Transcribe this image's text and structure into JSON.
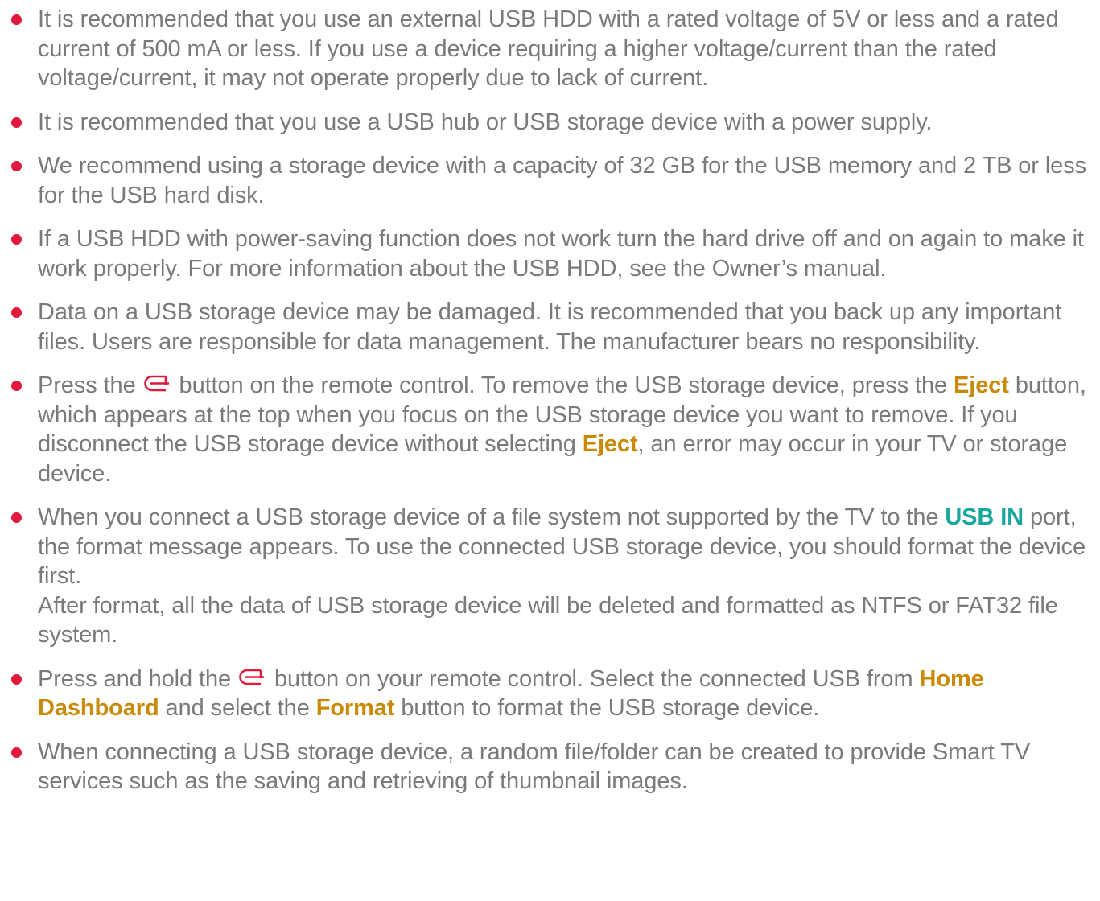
{
  "accent_colors": {
    "bullet": "#e0193d",
    "keyword_orange": "#c98a0a",
    "keyword_teal": "#1aa79d",
    "home_icon": "#e0193d"
  },
  "notes": [
    {
      "text": "It is recommended that you use an external USB HDD with a rated voltage of 5V or less and a rated current of 500 mA or less. If you use a device requiring a higher voltage/current than the rated voltage/current, it may not operate properly due to lack of current."
    },
    {
      "text": "It is recommended that you use a USB hub or USB storage device with a power supply."
    },
    {
      "text": "We recommend using a storage device with a capacity of 32 GB for the USB memory and 2 TB or less for the USB hard disk."
    },
    {
      "text": "If a USB HDD with power-saving function does not work turn the hard drive off and on again to make it work properly. For more information about the USB HDD, see the Owner’s manual."
    },
    {
      "text": "Data on a USB storage device may be damaged. It is recommended that you back up any important files. Users are responsible for data management. The manufacturer bears no responsibility."
    },
    {
      "part1": "Press the",
      "icon": "home-icon",
      "part2": "button on the remote control. To remove the USB storage device, press the",
      "kw1": "Eject",
      "part3": "button, which appears at the top when you focus on the USB storage device you want to remove. If you disconnect the USB storage device without selecting",
      "kw2": "Eject",
      "part4": ", an error may occur in your TV or storage device."
    },
    {
      "part1": "When you connect a USB storage device of a file system not supported by the TV to the",
      "kw1": "USB IN",
      "part2": "port, the format message appears. To use the connected USB storage device, you should format the device first.",
      "para2": "After format, all the data of USB storage device will be deleted and formatted as NTFS or FAT32 file system."
    },
    {
      "part1": "Press and hold the",
      "icon": "home-icon",
      "part2": "button on your remote control. Select the connected USB from",
      "kw1": "Home Dashboard",
      "part3": "and select the",
      "kw2": "Format",
      "part4": "button to format the USB storage device."
    },
    {
      "text": "When connecting a USB storage device, a random file/folder can be created to provide Smart TV services such as the saving and retrieving of thumbnail images."
    }
  ]
}
